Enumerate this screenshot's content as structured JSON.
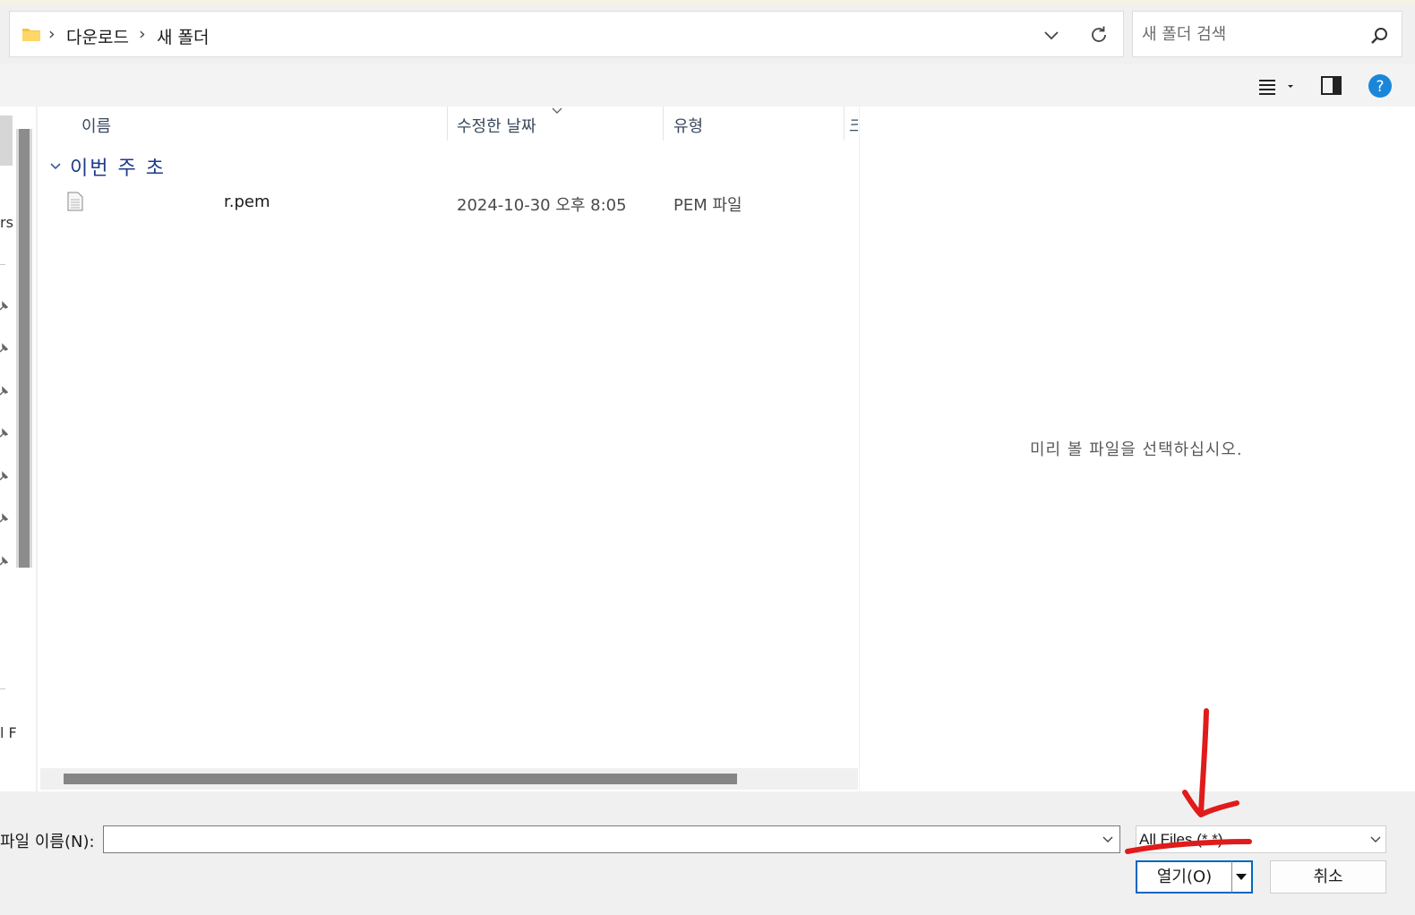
{
  "address_bar": {
    "breadcrumbs": [
      {
        "label": "다운로드"
      },
      {
        "label": "새 폴더"
      }
    ]
  },
  "search": {
    "placeholder": "새 폴더 검색"
  },
  "nav_pane": {
    "fragments": [
      "rs",
      "l F"
    ]
  },
  "columns": {
    "name": "이름",
    "modified": "수정한 날짜",
    "type": "유형",
    "size": "크"
  },
  "group": {
    "label": "이번 주 초"
  },
  "files": [
    {
      "name": "r.pem",
      "modified": "2024-10-30 오후 8:05",
      "type": "PEM 파일"
    }
  ],
  "preview": {
    "message": "미리 볼 파일을 선택하십시오."
  },
  "footer": {
    "filename_label": "파일 이름(N):",
    "filename_value": "",
    "filter_value": "All Files (*.*)",
    "open_label": "열기(O)",
    "cancel_label": "취소"
  },
  "colors": {
    "accent": "#0067c0",
    "help": "#1a86d9",
    "group_label": "#1e3a8a",
    "annotation": "#e01b1b"
  },
  "icons": [
    "folder-icon",
    "chevron-right-icon",
    "chevron-down-icon",
    "refresh-icon",
    "search-icon",
    "view-list-icon",
    "preview-pane-icon",
    "help-icon",
    "file-icon",
    "pin-icon"
  ]
}
